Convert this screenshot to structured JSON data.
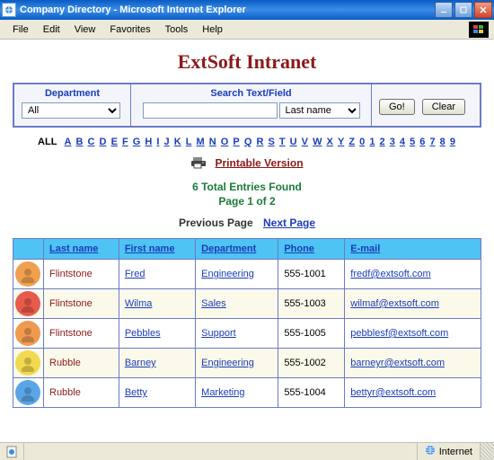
{
  "window": {
    "title": "Company Directory - Microsoft Internet Explorer"
  },
  "menu": [
    "File",
    "Edit",
    "View",
    "Favorites",
    "Tools",
    "Help"
  ],
  "heading": "ExtSoft Intranet",
  "panel": {
    "dept_label": "Department",
    "dept_value": "All",
    "search_label": "Search Text/Field",
    "search_value": "",
    "search_field_value": "Last name",
    "go_label": "Go!",
    "clear_label": "Clear"
  },
  "alphanav": {
    "all": "ALL",
    "letters": [
      "A",
      "B",
      "C",
      "D",
      "E",
      "F",
      "G",
      "H",
      "I",
      "J",
      "K",
      "L",
      "M",
      "N",
      "O",
      "P",
      "Q",
      "R",
      "S",
      "T",
      "U",
      "V",
      "W",
      "X",
      "Y",
      "Z",
      "0",
      "1",
      "2",
      "3",
      "4",
      "5",
      "6",
      "7",
      "8",
      "9"
    ]
  },
  "printable": "Printable Version",
  "status": "6 Total Entries Found",
  "page": "Page 1 of 2",
  "pagenav": {
    "prev": "Previous Page",
    "next": "Next Page"
  },
  "table": {
    "headers": [
      "Last name",
      "First name",
      "Department",
      "Phone",
      "E-mail"
    ],
    "rows": [
      {
        "avatar_bg": "#f0a050",
        "last": "Flintstone",
        "first": "Fred",
        "dept": "Engineering",
        "phone": "555-1001",
        "email": "fredf@extsoft.com"
      },
      {
        "avatar_bg": "#e85a4a",
        "last": "Flintstone",
        "first": "Wilma",
        "dept": "Sales",
        "phone": "555-1003",
        "email": "wilmaf@extsoft.com"
      },
      {
        "avatar_bg": "#f09a50",
        "last": "Flintstone",
        "first": "Pebbles",
        "dept": "Support",
        "phone": "555-1005",
        "email": "pebblesf@extsoft.com"
      },
      {
        "avatar_bg": "#f2d94e",
        "last": "Rubble",
        "first": "Barney",
        "dept": "Engineering",
        "phone": "555-1002",
        "email": "barneyr@extsoft.com"
      },
      {
        "avatar_bg": "#5aa5e8",
        "last": "Rubble",
        "first": "Betty",
        "dept": "Marketing",
        "phone": "555-1004",
        "email": "bettyr@extsoft.com"
      }
    ]
  },
  "statusbar": {
    "zone": "Internet"
  }
}
